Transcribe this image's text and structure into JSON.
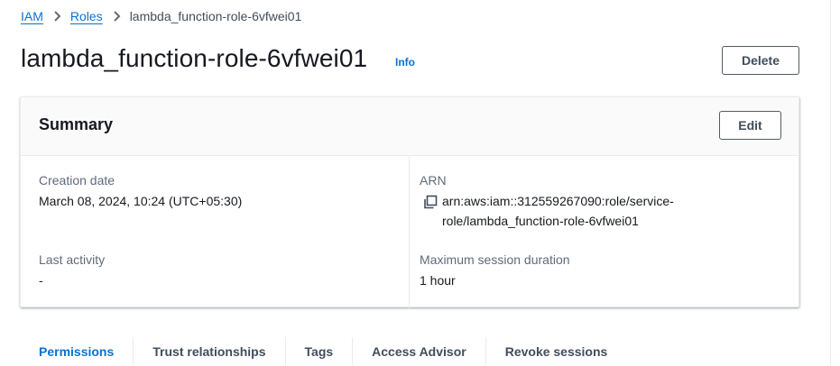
{
  "breadcrumb": {
    "items": [
      "IAM",
      "Roles"
    ],
    "current": "lambda_function-role-6vfwei01"
  },
  "header": {
    "title": "lambda_function-role-6vfwei01",
    "info_label": "Info",
    "delete_label": "Delete"
  },
  "summary": {
    "title": "Summary",
    "edit_label": "Edit",
    "creation_date_label": "Creation date",
    "creation_date_value": "March 08, 2024, 10:24 (UTC+05:30)",
    "last_activity_label": "Last activity",
    "last_activity_value": "-",
    "arn_label": "ARN",
    "arn_line1": "arn:aws:iam::312559267090:role/service-",
    "arn_line2": "role/lambda_function-role-6vfwei01",
    "max_session_label": "Maximum session duration",
    "max_session_value": "1 hour"
  },
  "tabs": [
    "Permissions",
    "Trust relationships",
    "Tags",
    "Access Advisor",
    "Revoke sessions"
  ],
  "icons": {
    "breadcrumb_separator": "chevron-right-icon",
    "copy": "copy-icon"
  },
  "colors": {
    "link": "#0972d3",
    "text": "#16191f",
    "label": "#5f6b7a",
    "header_bg": "#fafafa"
  }
}
